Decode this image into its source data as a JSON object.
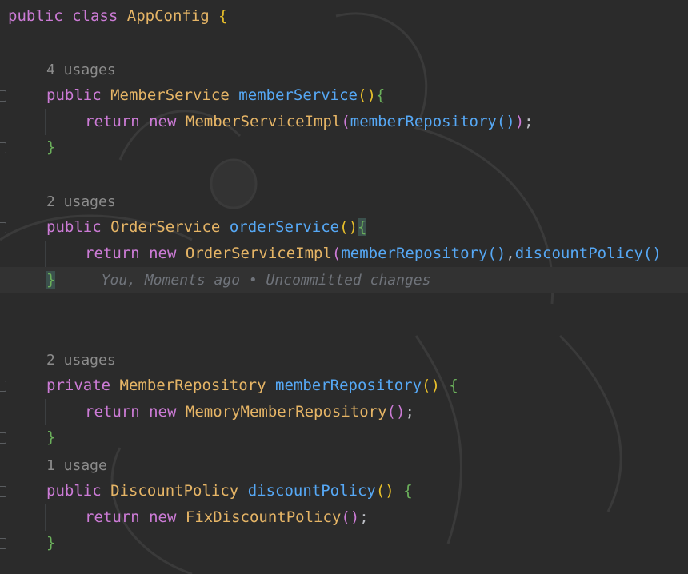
{
  "code": {
    "class_decl": {
      "kw1": "public",
      "kw2": "class",
      "name": "AppConfig",
      "brace": "{"
    },
    "blocks": [
      {
        "usages": "4 usages",
        "modifier": "public",
        "type": "MemberService",
        "method": "memberService",
        "open": "(",
        "close": ")",
        "brace_open": "{",
        "body_kw1": "return",
        "body_kw2": "new",
        "body_type": "MemberServiceImpl",
        "body_rest_1": "memberRepository",
        "body_tail": "());",
        "brace_close": "}"
      },
      {
        "usages": "2 usages",
        "modifier": "public",
        "type": "OrderService",
        "method": "orderService",
        "open": "(",
        "close": ")",
        "brace_open": "{",
        "body_kw1": "return",
        "body_kw2": "new",
        "body_type": "OrderServiceImpl",
        "body_arg1": "memberRepository",
        "body_arg2": "discountPolicy",
        "brace_close": "}",
        "blame": "You, Moments ago • Uncommitted changes"
      },
      {
        "usages": "2 usages",
        "modifier": "private",
        "type": "MemberRepository",
        "method": "memberRepository",
        "brace_open": "{",
        "body_kw1": "return",
        "body_kw2": "new",
        "body_type": "MemoryMemberRepository",
        "brace_close": "}"
      },
      {
        "usages": "1 usage",
        "modifier": "public",
        "type": "DiscountPolicy",
        "method": "discountPolicy",
        "brace_open": "{",
        "body_kw1": "return",
        "body_kw2": "new",
        "body_type": "FixDiscountPolicy",
        "brace_close": "}"
      }
    ]
  },
  "colors": {
    "background": "#2b2b2b",
    "keyword": "#cc7bd6",
    "type": "#e6b566",
    "method": "#56a8f5",
    "brace": "#6bb05b"
  }
}
